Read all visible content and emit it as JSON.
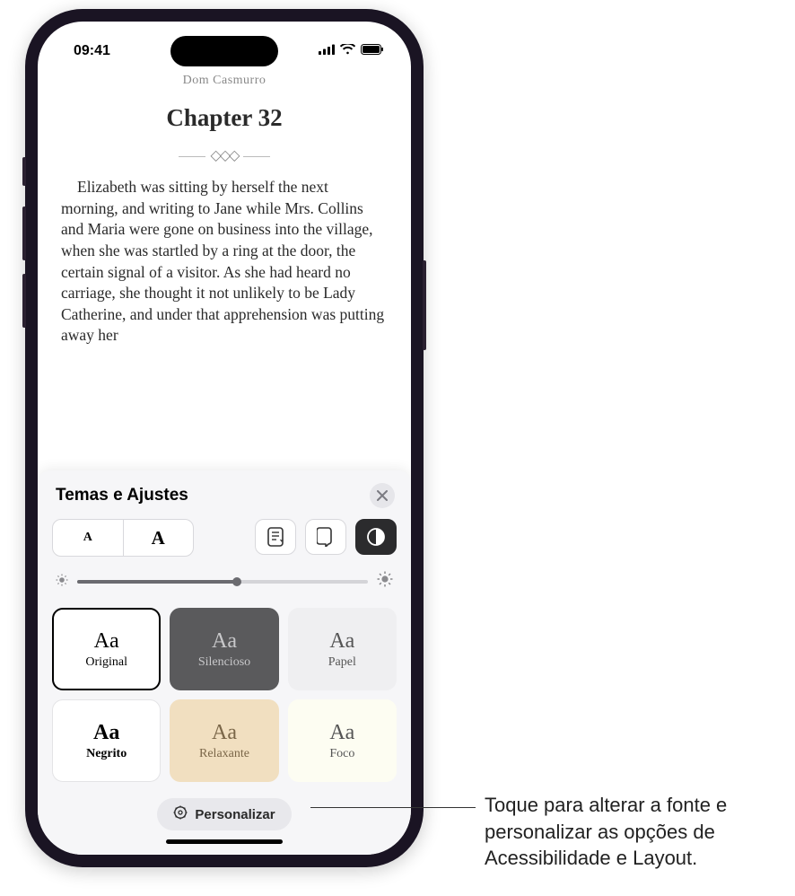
{
  "status": {
    "time": "09:41"
  },
  "book": {
    "title": "Dom Casmurro",
    "chapter": "Chapter 32",
    "body": "Elizabeth was sitting by herself the next morning, and writing to Jane while Mrs. Collins and Maria were gone on business into the village, when she was startled by a ring at the door, the certain signal of a visitor. As she had heard no carriage, she thought it not unlikely to be Lady Catherine, and under that apprehension was putting away her"
  },
  "sheet": {
    "title": "Temas e Ajustes",
    "font_small": "A",
    "font_large": "A",
    "themes": [
      {
        "aa": "Aa",
        "label": "Original"
      },
      {
        "aa": "Aa",
        "label": "Silencioso"
      },
      {
        "aa": "Aa",
        "label": "Papel"
      },
      {
        "aa": "Aa",
        "label": "Negrito"
      },
      {
        "aa": "Aa",
        "label": "Relaxante"
      },
      {
        "aa": "Aa",
        "label": "Foco"
      }
    ],
    "customize_label": "Personalizar"
  },
  "callout": "Toque para alterar a fonte e personalizar as opções de Acessibilidade e Layout."
}
